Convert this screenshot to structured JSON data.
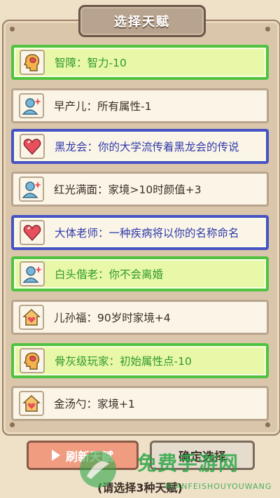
{
  "header": {
    "title": "选择天赋"
  },
  "talents": [
    {
      "label": "智障：智力-10",
      "style": "green",
      "icon": "head-brain-icon"
    },
    {
      "label": "早产儿：所有属性-1",
      "style": "white",
      "icon": "person-sparkle-icon"
    },
    {
      "label": "黑龙会：你的大学流传着黑龙会的传说",
      "style": "blue",
      "icon": "heart-icon"
    },
    {
      "label": "红光满面：家境>10时颜值+3",
      "style": "white",
      "icon": "person-sparkle-icon"
    },
    {
      "label": "大体老师：一种疾病将以你的名称命名",
      "style": "blue",
      "icon": "heart-icon"
    },
    {
      "label": "白头偕老：你不会离婚",
      "style": "green",
      "icon": "person-sparkle-icon"
    },
    {
      "label": "儿孙福：90岁时家境+4",
      "style": "white",
      "icon": "house-heart-icon"
    },
    {
      "label": "骨灰级玩家：初始属性点-10",
      "style": "green",
      "icon": "head-brain-icon"
    },
    {
      "label": "金汤勺：家境+1",
      "style": "white",
      "icon": "house-heart-icon"
    }
  ],
  "buttons": {
    "refresh": "刷新天赋",
    "confirm": "确定选择"
  },
  "hint": "(请选择3种天赋)",
  "watermark": {
    "main": "免费手游网",
    "sub": "MIANFEISHOUYOUWANG"
  },
  "colors": {
    "green_border": "#4fc33f",
    "blue_border": "#4752c4",
    "icon_orange": "#f5b14a",
    "icon_blue": "#78b6d9",
    "icon_heart": "#e8505b"
  }
}
